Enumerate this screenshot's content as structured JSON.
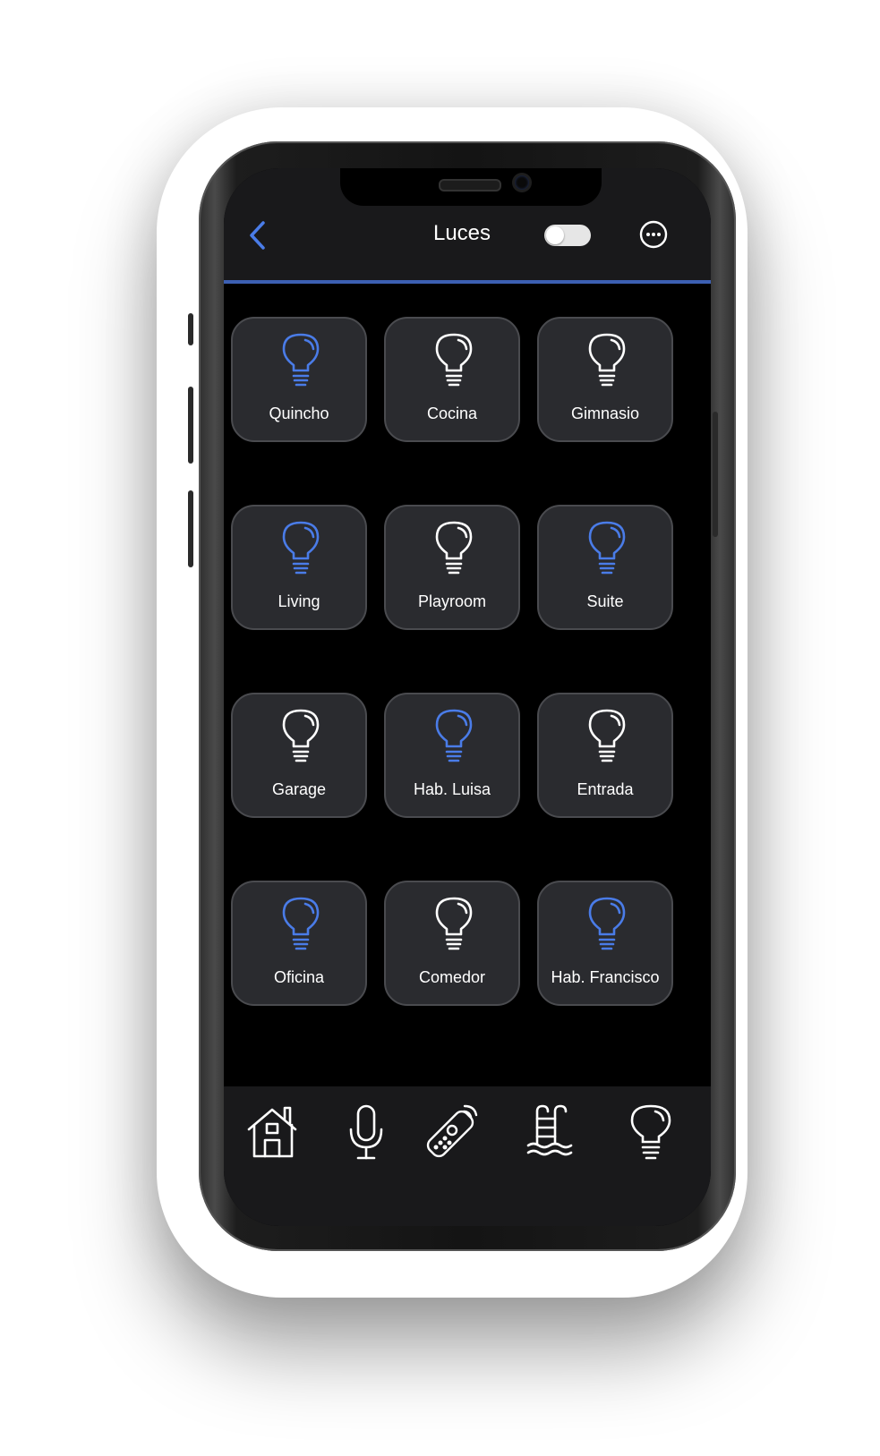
{
  "header": {
    "title": "Luces",
    "toggle_on": false
  },
  "colors": {
    "accent": "#4a7ce8",
    "icon_off": "#ffffff",
    "tile_bg": "#2a2b2f",
    "bar_bg": "#19191b"
  },
  "lights": [
    {
      "label": "Quincho",
      "on": true
    },
    {
      "label": "Cocina",
      "on": false
    },
    {
      "label": "Gimnasio",
      "on": false
    },
    {
      "label": "Living",
      "on": true
    },
    {
      "label": "Playroom",
      "on": false
    },
    {
      "label": "Suite",
      "on": true
    },
    {
      "label": "Garage",
      "on": false
    },
    {
      "label": "Hab. Luisa",
      "on": true
    },
    {
      "label": "Entrada",
      "on": false
    },
    {
      "label": "Oficina",
      "on": true
    },
    {
      "label": "Comedor",
      "on": false
    },
    {
      "label": "Hab. Francisco",
      "on": true
    }
  ],
  "bottom_nav": [
    {
      "icon": "home-icon"
    },
    {
      "icon": "microphone-icon"
    },
    {
      "icon": "remote-control-icon"
    },
    {
      "icon": "pool-icon"
    },
    {
      "icon": "lightbulb-icon"
    }
  ]
}
